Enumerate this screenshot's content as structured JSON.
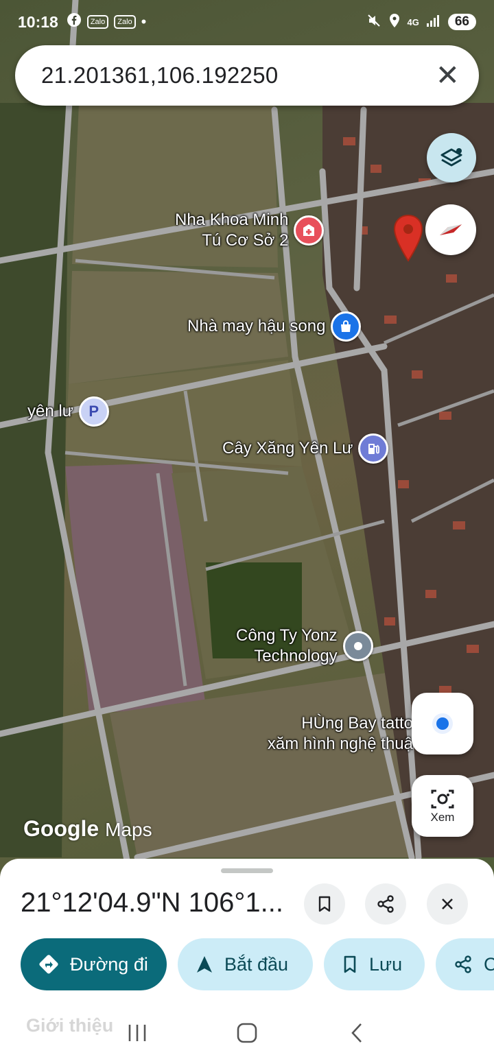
{
  "status_bar": {
    "time": "10:18",
    "app_chips": [
      "Zalo",
      "Zalo"
    ],
    "network": "4G",
    "battery": "66"
  },
  "search": {
    "query": "21.201361,106.192250"
  },
  "map": {
    "pois": [
      {
        "name": "Nha Khoa Minh Tú Cơ Sở 2",
        "line1": "Nha Khoa Minh",
        "line2": "Tú Cơ Sở 2",
        "icon": "hospital-icon",
        "color": "#e8505b"
      },
      {
        "name": "Nhà may hậu song",
        "icon": "shopping-bag-icon",
        "color": "#1a73e8"
      },
      {
        "name": "yên lư",
        "icon": "parking-icon",
        "symbol": "P",
        "color": "#6f7cd6"
      },
      {
        "name": "Cây Xăng Yên Lư",
        "icon": "gas-station-icon",
        "color": "#6f7cd6"
      },
      {
        "name": "Công Ty Yonz Technology",
        "line1": "Công Ty Yonz",
        "line2": "Technology",
        "icon": "generic-place-icon",
        "color": "#7a8a99"
      },
      {
        "name": "HÙng Bay tattoo xăm hình nghệ thuật",
        "line1": "HÙng Bay tatto",
        "line2": "xăm hình nghệ thuậ",
        "icon": "",
        "color": ""
      }
    ],
    "logo_google": "Google",
    "logo_maps": "Maps",
    "xem_label": "Xem",
    "pin_color": "#d93025"
  },
  "sheet": {
    "title": "21°12'04.9\"N 106°1...",
    "actions": [
      {
        "label": "Đường đi",
        "icon": "directions-icon"
      },
      {
        "label": "Bắt đầu",
        "icon": "navigation-arrow-icon"
      },
      {
        "label": "Lưu",
        "icon": "bookmark-icon"
      },
      {
        "label": "C",
        "icon": "share-icon"
      }
    ],
    "tab_hint": "Giới thiệu"
  }
}
